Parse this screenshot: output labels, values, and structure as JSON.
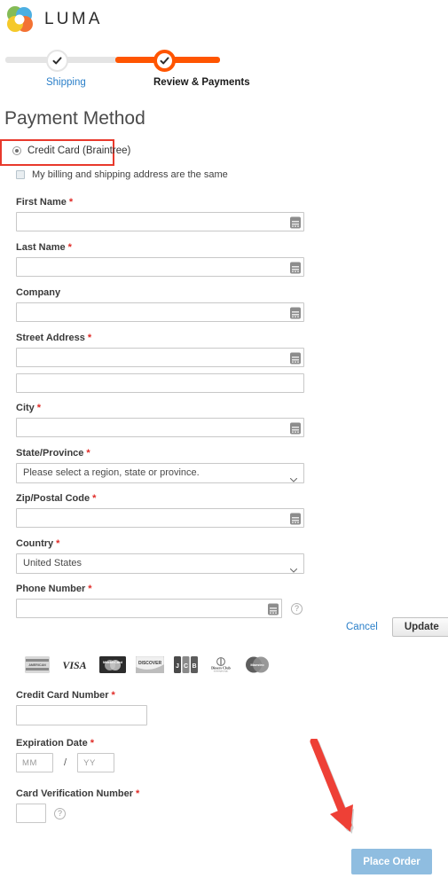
{
  "brand": {
    "name": "LUMA",
    "logo_icon": "luma-flower-logo",
    "colors": {
      "green": "#7ab648",
      "blue": "#3da9e0",
      "orange": "#f26722",
      "yellow": "#f5c518"
    }
  },
  "progress": {
    "steps": [
      {
        "label": "Shipping",
        "state": "complete",
        "icon": "check-icon"
      },
      {
        "label": "Review & Payments",
        "state": "current",
        "icon": "check-icon"
      }
    ],
    "colors": {
      "active": "#ff5501",
      "inactive": "#e4e4e4",
      "link": "#2a7fc9"
    }
  },
  "page": {
    "title": "Payment Method"
  },
  "payment_method": {
    "selected": "Credit Card (Braintree)",
    "radio_label": "Credit Card (Braintree)",
    "billing_same_label": "My billing and shipping address are the same",
    "billing_same_checked": false,
    "annotation_color": "#e8392c"
  },
  "billing_form": {
    "required_marker": "*",
    "fields": [
      {
        "label": "First Name",
        "required": true,
        "value": "",
        "placeholder": "",
        "type": "text",
        "autofill": true
      },
      {
        "label": "Last Name",
        "required": true,
        "value": "",
        "placeholder": "",
        "type": "text",
        "autofill": true
      },
      {
        "label": "Company",
        "required": false,
        "value": "",
        "placeholder": "",
        "type": "text",
        "autofill": true
      },
      {
        "label": "Street Address",
        "required": true,
        "value": "",
        "placeholder": "",
        "type": "text",
        "autofill": true
      },
      {
        "label": "",
        "required": false,
        "value": "",
        "placeholder": "",
        "type": "text",
        "autofill": false
      },
      {
        "label": "City",
        "required": true,
        "value": "",
        "placeholder": "",
        "type": "text",
        "autofill": true
      },
      {
        "label": "State/Province",
        "required": true,
        "value": "Please select a region, state or province.",
        "type": "select",
        "autofill": false
      },
      {
        "label": "Zip/Postal Code",
        "required": true,
        "value": "",
        "placeholder": "",
        "type": "text",
        "autofill": true
      },
      {
        "label": "Country",
        "required": true,
        "value": "United States",
        "type": "select",
        "autofill": false
      },
      {
        "label": "Phone Number",
        "required": true,
        "value": "",
        "placeholder": "",
        "type": "text",
        "autofill": true,
        "help": "?"
      }
    ],
    "state_placeholder": "Please select a region, state or province.",
    "country_value": "United States",
    "phone_help_icon": "question-mark-icon"
  },
  "actions": {
    "cancel_label": "Cancel",
    "update_label": "Update"
  },
  "accepted_cards": [
    {
      "name": "American Express",
      "icon": "amex-card-icon"
    },
    {
      "name": "VISA",
      "icon": "visa-card-icon"
    },
    {
      "name": "MasterCard",
      "icon": "mastercard-card-icon"
    },
    {
      "name": "Discover",
      "icon": "discover-card-icon"
    },
    {
      "name": "JCB",
      "icon": "jcb-card-icon"
    },
    {
      "name": "Diners Club",
      "icon": "diners-club-card-icon"
    },
    {
      "name": "Maestro",
      "icon": "maestro-card-icon"
    }
  ],
  "card_form": {
    "number_label": "Credit Card Number",
    "number_value": "",
    "expiration_label": "Expiration Date",
    "month_placeholder": "MM",
    "month_value": "",
    "year_placeholder": "YY",
    "year_value": "",
    "date_separator": "/",
    "cvv_label": "Card Verification Number",
    "cvv_value": "",
    "cvv_help_icon": "question-mark-icon",
    "required_marker": "*"
  },
  "place_order": {
    "label": "Place Order",
    "enabled": false,
    "color": "#8fbde0"
  },
  "annotations": {
    "arrow_color": "#ee4036",
    "arrow_target": "Place Order"
  }
}
